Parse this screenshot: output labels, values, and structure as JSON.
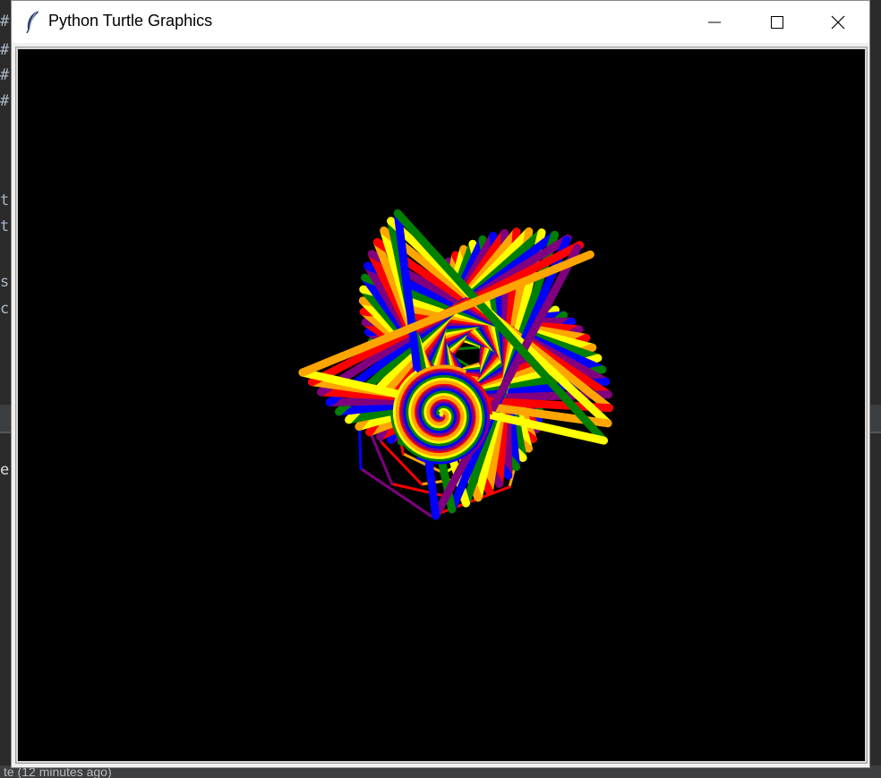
{
  "window": {
    "title": "Python Turtle Graphics",
    "controls": [
      "minimize-icon",
      "maximize-icon",
      "close-icon"
    ]
  },
  "ide_background": {
    "status_text": "te (12 minutes ago)"
  },
  "drawing": {
    "background": "#000000",
    "palette": [
      "#ff0000",
      "#800080",
      "#0000ff",
      "#008000",
      "#ffff00",
      "#ffa500"
    ]
  }
}
